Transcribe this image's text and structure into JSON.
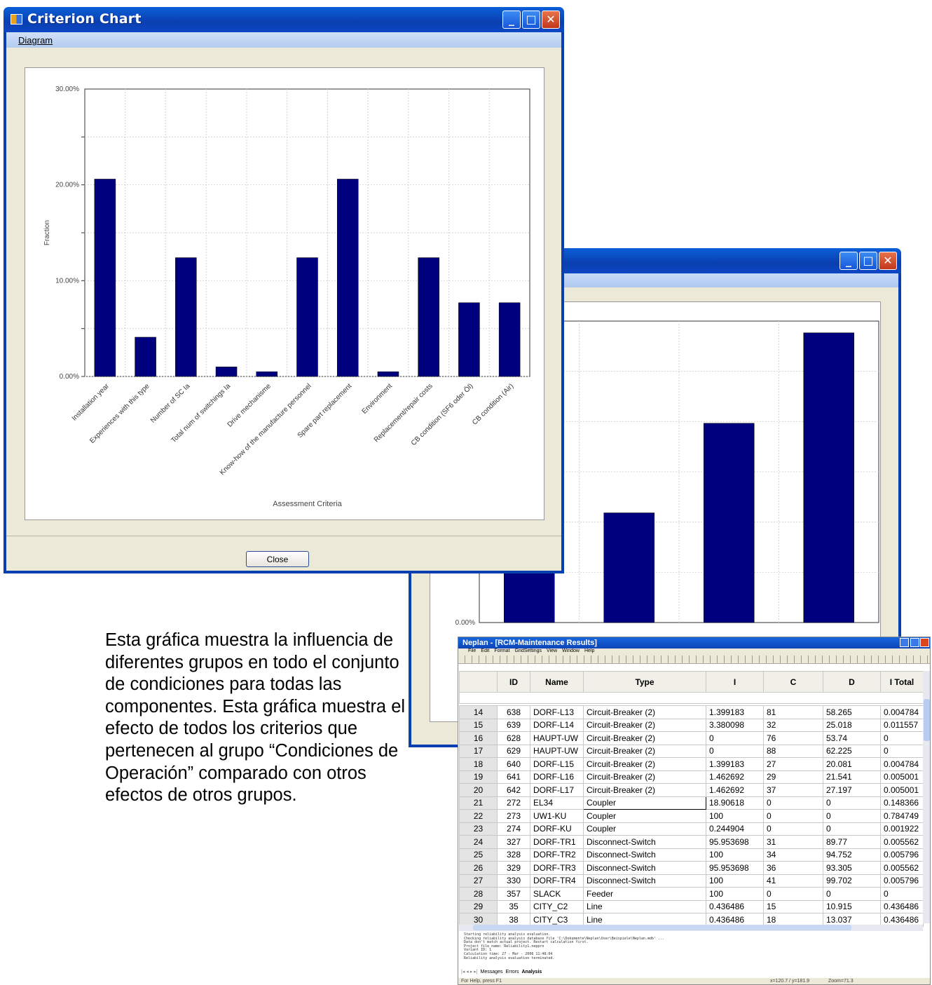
{
  "criterion_window": {
    "title": "Criterion Chart",
    "menu": "Diagram",
    "close_label": "Close",
    "chart_data": {
      "type": "bar",
      "categories": [
        "Installation year",
        "Experiences with this type",
        "Number of SC Ia",
        "Total num of switchings Ia",
        "Drive mechanisme",
        "Know-how of the manufacture personnel",
        "Spare part replacement",
        "Environment",
        "Replacement/repair costs",
        "CB condition (SF6 oder Öl)",
        "CB condition (Air)"
      ],
      "values": [
        20.6,
        4.1,
        12.4,
        1.0,
        0.5,
        12.4,
        20.6,
        0.5,
        12.4,
        7.7,
        7.7
      ],
      "ylim": [
        0,
        30
      ],
      "yticks": [
        "0.00%",
        "10.00%",
        "20.00%",
        "30.00%"
      ],
      "ylabel": "Fraction",
      "xlabel": "Assessment Criteria",
      "bar_color": "#00007f"
    }
  },
  "back_window": {
    "ytick_label": "0.00%",
    "chart_data": {
      "type": "bar",
      "values": [
        6.0,
        13.1,
        23.8,
        34.6
      ],
      "ylim": [
        0,
        36
      ],
      "bar_color": "#00007f"
    }
  },
  "description": "Esta gráfica muestra la influencia de diferentes grupos en todo el conjunto de condiciones para todas las componentes. Esta gráfica muestra el efecto de todos los criterios que pertenecen al grupo “Condiciones de Operación” comparado con otros efectos de otros grupos.",
  "neplan": {
    "title": "Neplan - [RCM-Maintenance Results]",
    "menu": [
      "File",
      "Edit",
      "Format",
      "GridSettings",
      "View",
      "Window",
      "Help"
    ],
    "columns": [
      "ID",
      "Name",
      "Type",
      "I",
      "C",
      "D",
      "I Total"
    ],
    "rows": [
      [
        "14",
        "638",
        "DORF-L13",
        "Circuit-Breaker (2)",
        "1.399183",
        "81",
        "58.265",
        "0.004784"
      ],
      [
        "15",
        "639",
        "DORF-L14",
        "Circuit-Breaker (2)",
        "3.380098",
        "32",
        "25.018",
        "0.011557"
      ],
      [
        "16",
        "628",
        "HAUPT-UW",
        "Circuit-Breaker (2)",
        "0",
        "76",
        "53.74",
        "0"
      ],
      [
        "17",
        "629",
        "HAUPT-UW",
        "Circuit-Breaker (2)",
        "0",
        "88",
        "62.225",
        "0"
      ],
      [
        "18",
        "640",
        "DORF-L15",
        "Circuit-Breaker (2)",
        "1.399183",
        "27",
        "20.081",
        "0.004784"
      ],
      [
        "19",
        "641",
        "DORF-L16",
        "Circuit-Breaker (2)",
        "1.462692",
        "29",
        "21.541",
        "0.005001"
      ],
      [
        "20",
        "642",
        "DORF-L17",
        "Circuit-Breaker (2)",
        "1.462692",
        "37",
        "27.197",
        "0.005001"
      ],
      [
        "21",
        "272",
        "EL34",
        "Coupler",
        "18.90618",
        "0",
        "0",
        "0.148366"
      ],
      [
        "22",
        "273",
        "UW1-KU",
        "Coupler",
        "100",
        "0",
        "0",
        "0.784749"
      ],
      [
        "23",
        "274",
        "DORF-KU",
        "Coupler",
        "0.244904",
        "0",
        "0",
        "0.001922"
      ],
      [
        "24",
        "327",
        "DORF-TR1",
        "Disconnect-Switch",
        "95.953698",
        "31",
        "89.77",
        "0.005562"
      ],
      [
        "25",
        "328",
        "DORF-TR2",
        "Disconnect-Switch",
        "100",
        "34",
        "94.752",
        "0.005796"
      ],
      [
        "26",
        "329",
        "DORF-TR3",
        "Disconnect-Switch",
        "95.953698",
        "36",
        "93.305",
        "0.005562"
      ],
      [
        "27",
        "330",
        "DORF-TR4",
        "Disconnect-Switch",
        "100",
        "41",
        "99.702",
        "0.005796"
      ],
      [
        "28",
        "357",
        "SLACK",
        "Feeder",
        "100",
        "0",
        "0",
        "0"
      ],
      [
        "29",
        "35",
        "CITY_C2",
        "Line",
        "0.436486",
        "15",
        "10.915",
        "0.436486"
      ],
      [
        "30",
        "38",
        "CITY_C3",
        "Line",
        "0.436486",
        "18",
        "13.037",
        "0.436486"
      ]
    ],
    "log_lines": [
      "Starting reliability analysis evaluation.",
      "Checking reliability analysis database file 'C:\\Dokumente\\Neplan\\User\\Beispiele\\Neplan.mdb' ...",
      "Data don't match actual project. Restart calculation first.",
      "Project file name: Reliability1.neppro",
      "Variant ID: 1",
      "Calculation time: 27 - Mar - 2006 11:48:04",
      "Reliability analysis evaluation terminated."
    ],
    "tabs": [
      "Messages",
      "Errors",
      "Analysis"
    ],
    "status_left": "For Help, press F1",
    "status_coords": "x=120.7 / y=181.9",
    "status_zoom": "Zoom=71.3"
  }
}
